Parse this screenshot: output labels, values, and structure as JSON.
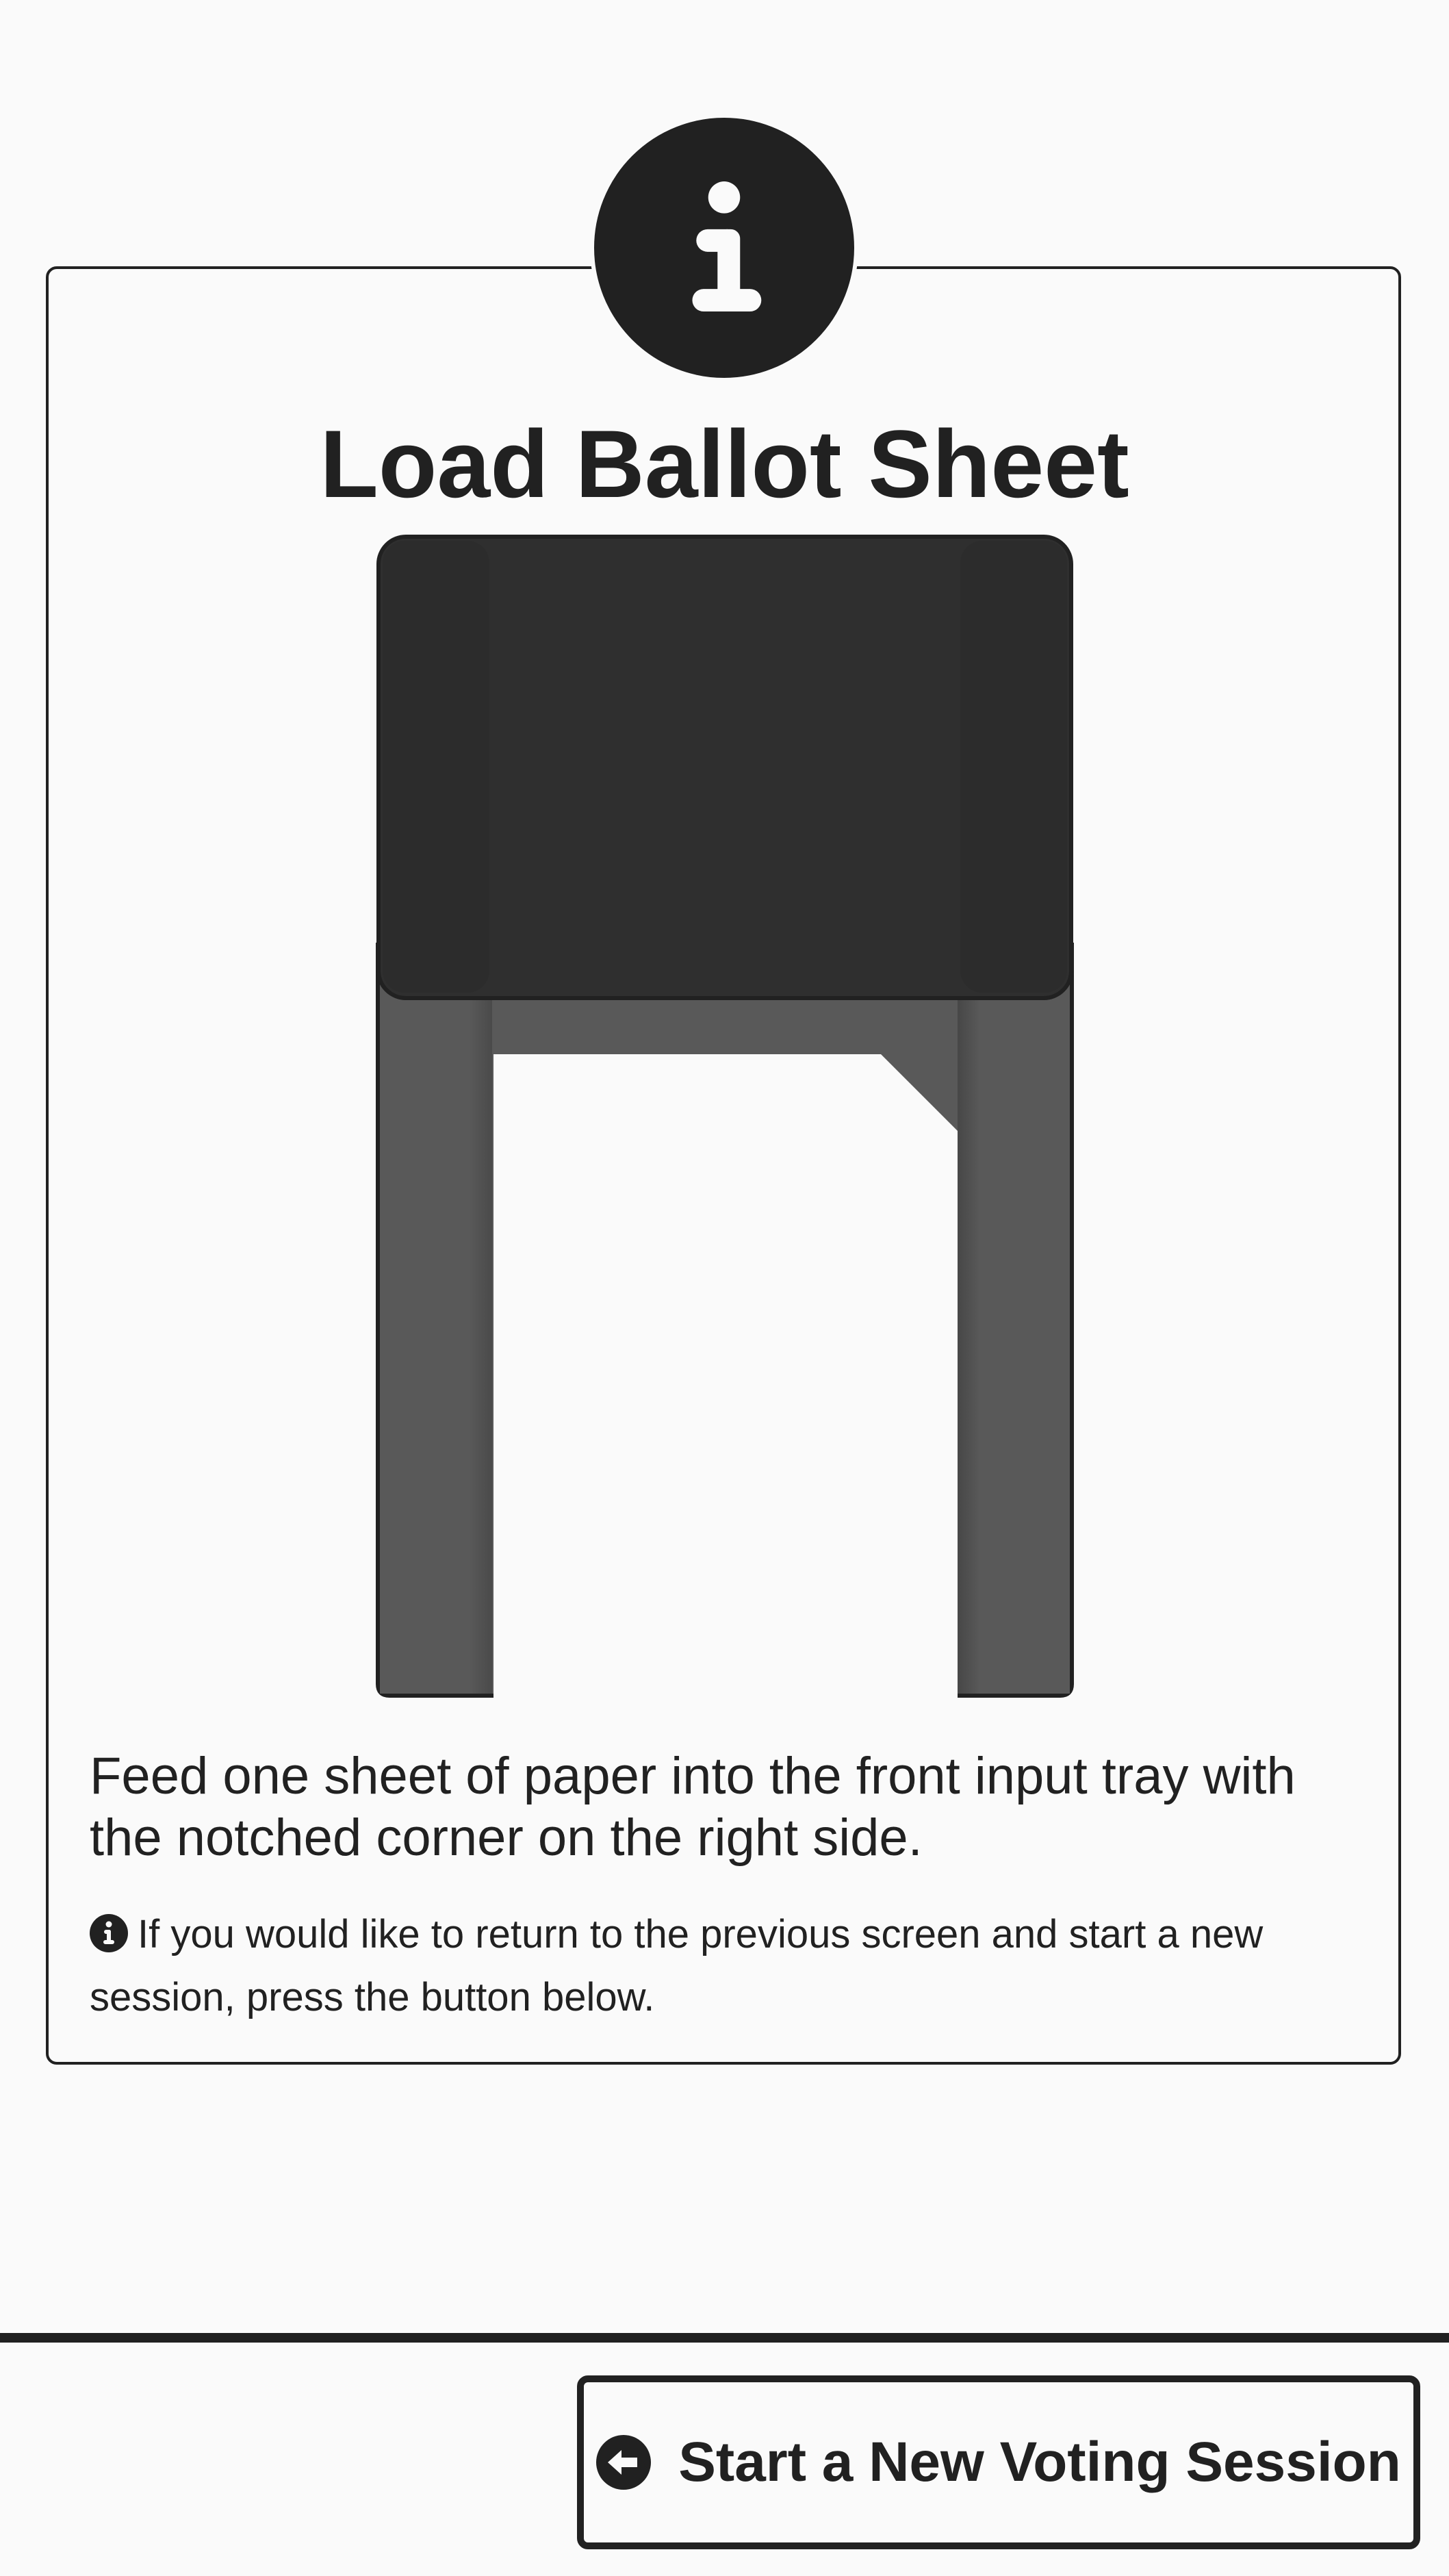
{
  "modal": {
    "title": "Load Ballot Sheet",
    "badge_icon": "info-icon",
    "instructions": "Feed one sheet of paper into the front input tray with the notched corner on the right side.",
    "note_icon": "info-circle-icon",
    "note": "If you would like to return to the previous screen and start a new session, press the button below."
  },
  "illustration": {
    "icon": "ballot-tray-illustration",
    "notched_corner": "right"
  },
  "footer": {
    "button_label": "Start a New Voting Session",
    "button_icon": "arrow-circle-left-icon"
  },
  "colors": {
    "background": "#fafafa",
    "foreground": "#212121",
    "printer_dark": "#2f2f2f",
    "printer_tray": "#595959"
  }
}
